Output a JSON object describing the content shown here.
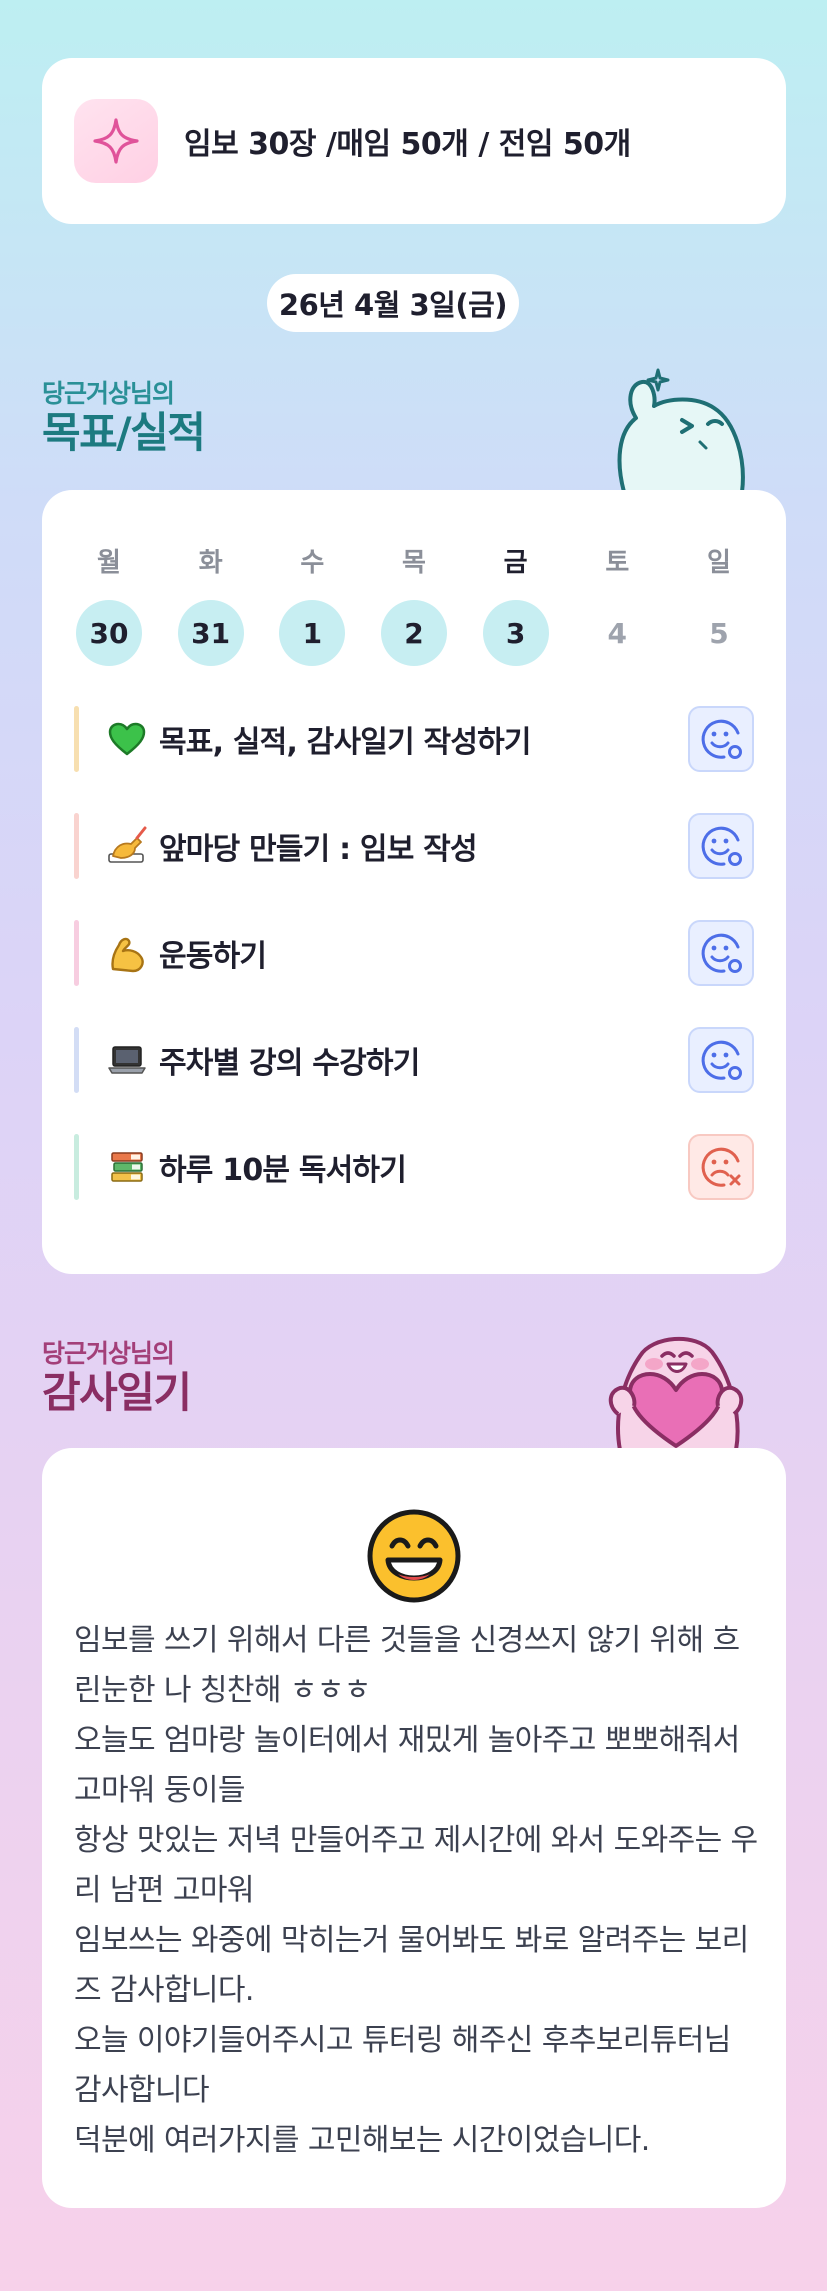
{
  "goal": {
    "text": "임보 30장 /매임 50개 / 전임 50개",
    "icon": "sparkle-icon"
  },
  "date": "26년 4월 3일(금)",
  "goals_section": {
    "subtitle": "당근거상님의",
    "title": "목표/실적"
  },
  "week": [
    {
      "label": "월",
      "date": "30",
      "state": "done"
    },
    {
      "label": "화",
      "date": "31",
      "state": "done"
    },
    {
      "label": "수",
      "date": "1",
      "state": "done"
    },
    {
      "label": "목",
      "date": "2",
      "state": "done"
    },
    {
      "label": "금",
      "date": "3",
      "state": "done",
      "today": true
    },
    {
      "label": "토",
      "date": "4",
      "state": "future"
    },
    {
      "label": "일",
      "date": "5",
      "state": "future"
    }
  ],
  "tasks": [
    {
      "label": "목표, 실적, 감사일기 작성하기",
      "icon": "green-heart-icon",
      "bar_color": "#f7dfb0",
      "status": "done"
    },
    {
      "label": "앞마당 만들기 : 임보 작성",
      "icon": "writing-hand-icon",
      "bar_color": "#f9d3cf",
      "status": "done"
    },
    {
      "label": "운동하기",
      "icon": "flexed-biceps-icon",
      "bar_color": "#f7cde0",
      "status": "done"
    },
    {
      "label": "주차별 강의 수강하기",
      "icon": "laptop-icon",
      "bar_color": "#d3ddf5",
      "status": "done"
    },
    {
      "label": "하루 10분 독서하기",
      "icon": "books-icon",
      "bar_color": "#c8ecdf",
      "status": "missed"
    }
  ],
  "thanks_section": {
    "subtitle": "당근거상님의",
    "title": "감사일기"
  },
  "thanks": {
    "emoji": "grinning-face-icon",
    "lines": [
      "임보를 쓰기 위해서 다른 것들을 신경쓰지 않기 위해 흐린눈한 나 칭찬해 ㅎㅎㅎ",
      "오늘도 엄마랑 놀이터에서 재밌게 놀아주고 뽀뽀해줘서 고마워 둥이들",
      "항상 맛있는 저녁 만들어주고 제시간에 와서 도와주는 우리 남편 고마워",
      "임보쓰는 와중에 막히는거 물어봐도 봐로 알려주는 보리즈 감사합니다.",
      "오늘 이야기들어주시고 튜터링 해주신 후추보리튜터님 감사합니다",
      "덕분에 여러가지를 고민해보는 시간이었습니다."
    ]
  },
  "colors": {
    "accent_teal": "#1c7a80",
    "accent_plum": "#8a2e63",
    "done_circle": "#c7eef2"
  }
}
